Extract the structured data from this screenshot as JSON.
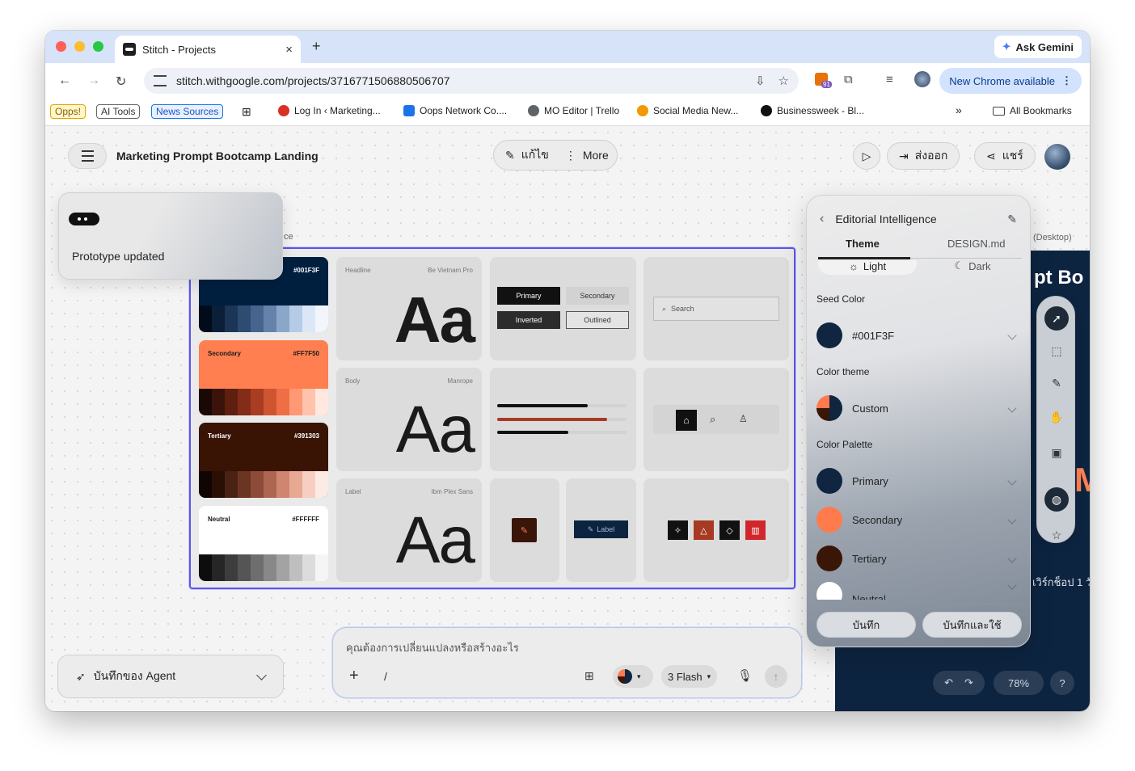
{
  "browser": {
    "tab_title": "Stitch - Projects",
    "tab_close": "×",
    "new_tab": "+",
    "ask_gemini": "Ask Gemini",
    "url": "stitch.withgoogle.com/projects/3716771506880506707",
    "extension_badge": "91",
    "new_chrome": "New Chrome available",
    "bookmarks": [
      {
        "label": "Opps!"
      },
      {
        "label": "AI Tools"
      },
      {
        "label": "News Sources"
      },
      {
        "label": "Log In ‹ Marketing..."
      },
      {
        "label": "Oops Network Co...."
      },
      {
        "label": "MO Editor | Trello"
      },
      {
        "label": "Social Media New..."
      },
      {
        "label": "Businessweek - Bl..."
      }
    ],
    "more_bookmarks": "»",
    "all_bookmarks": "All Bookmarks"
  },
  "app": {
    "project_title": "Marketing Prompt Bootcamp Landing",
    "edit_label": "แก้ไข",
    "more_label": "More",
    "export_label": "ส่งออก",
    "share_label": "แชร์",
    "toast_text": "Prototype updated",
    "frame_label_fragment": "ce",
    "desktop_label": "(Desktop)"
  },
  "design_board": {
    "swatches": [
      {
        "name": "",
        "hex": "#001F3F",
        "color": "#001f3f",
        "text_color": "#ffffff",
        "ramp": [
          "#000c1a",
          "#0b2038",
          "#1c3556",
          "#2e4b72",
          "#46658e",
          "#6583aa",
          "#8aa6c9",
          "#b5cbe6",
          "#dbe7f6",
          "#f2f6fc"
        ]
      },
      {
        "name": "Secondary",
        "hex": "#FF7F50",
        "color": "#ff7f50",
        "text_color": "#1a1a1a",
        "ramp": [
          "#1a0805",
          "#3b130a",
          "#5e1f10",
          "#832c17",
          "#a83d21",
          "#cf5531",
          "#f06e45",
          "#ff9874",
          "#ffc3ab",
          "#ffe9df"
        ]
      },
      {
        "name": "Tertiary",
        "hex": "#391303",
        "color": "#391303",
        "text_color": "#ffffff",
        "ramp": [
          "#0f0502",
          "#2a0f06",
          "#4a2214",
          "#6b3524",
          "#8c4c39",
          "#ad6652",
          "#cf8570",
          "#e8a994",
          "#f6cfc2",
          "#fcebe5"
        ]
      },
      {
        "name": "Neutral",
        "hex": "#FFFFFF",
        "color": "#ffffff",
        "text_color": "#1a1a1a",
        "ramp": [
          "#0d0d0d",
          "#262626",
          "#3d3d3d",
          "#555555",
          "#6e6e6e",
          "#888888",
          "#a3a3a3",
          "#bfbfbf",
          "#dcdcdc",
          "#f5f5f5"
        ]
      }
    ],
    "typography": [
      {
        "role": "Headline",
        "font": "Be Vietnam Pro",
        "sample": "Aa"
      },
      {
        "role": "Body",
        "font": "Manrope",
        "sample": "Aa"
      },
      {
        "role": "Label",
        "font": "Ibm Plex Sans",
        "sample": "Aa"
      }
    ],
    "buttons": {
      "primary": "Primary",
      "secondary": "Secondary",
      "inverted": "Inverted",
      "outlined": "Outlined"
    },
    "search_placeholder": "Search",
    "chip_label": "Label"
  },
  "theme_panel": {
    "title": "Editorial Intelligence",
    "tabs": [
      "Theme",
      "DESIGN.md"
    ],
    "modes": [
      "Light",
      "Dark"
    ],
    "seed_color_heading": "Seed Color",
    "seed_color_value": "#001F3F",
    "color_theme_heading": "Color theme",
    "color_theme_value": "Custom",
    "palette_heading": "Color Palette",
    "palette": [
      {
        "name": "Primary",
        "color": "#0f2540"
      },
      {
        "name": "Secondary",
        "color": "#ff7a4d"
      },
      {
        "name": "Tertiary",
        "color": "#3a1608"
      },
      {
        "name": "Neutral",
        "color": "#ffffff"
      }
    ],
    "save": "บันทึก",
    "save_apply": "บันทึกและใช้"
  },
  "preview": {
    "title_fragment": "pt Bo",
    "subtitle_fragment": "เวิร์กช็อป 1 วั",
    "zoom": "78%",
    "help": "?"
  },
  "prompt_box": {
    "placeholder": "คุณต้องการเปลี่ยนแปลงหรือสร้างอะไร",
    "slash": "/",
    "model": "3 Flash"
  },
  "agent_log": {
    "label": "บันทึกของ Agent"
  }
}
